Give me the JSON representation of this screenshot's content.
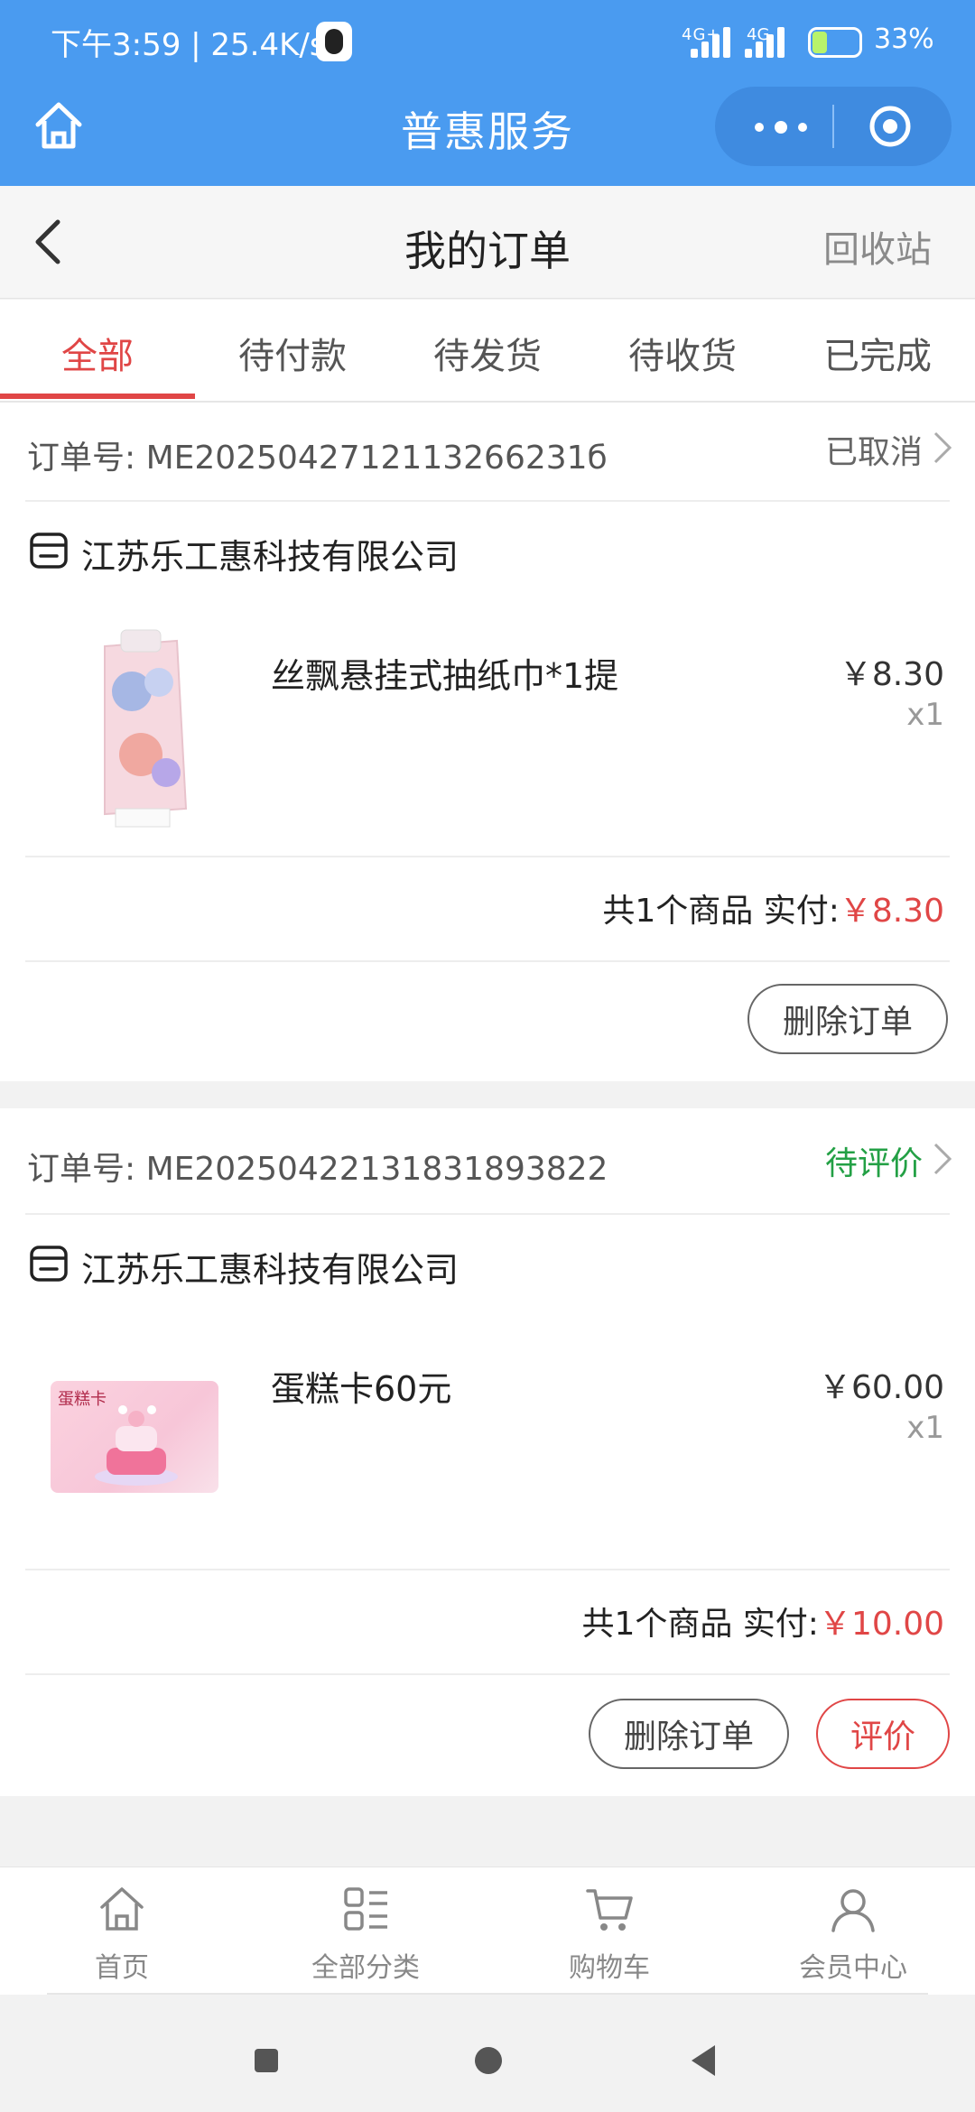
{
  "status_bar": {
    "time_speed": "下午3:59 | 25.4K/s",
    "network_1": "4G+",
    "network_2": "4G",
    "battery_percent": "33%"
  },
  "mini_program": {
    "title": "普惠服务"
  },
  "page": {
    "title": "我的订单",
    "recycle_bin": "回收站"
  },
  "tabs": [
    {
      "label": "全部",
      "active": true
    },
    {
      "label": "待付款"
    },
    {
      "label": "待发货"
    },
    {
      "label": "待收货"
    },
    {
      "label": "已完成"
    }
  ],
  "orders": [
    {
      "order_no": "订单号: ME2025042712113266231б",
      "status": "已取消",
      "shop": "江苏乐工惠科技有限公司",
      "product_name": "丝飘悬挂式抽纸巾*1提",
      "price": "￥8.30",
      "qty": "x1",
      "summary_prefix": "共1个商品 实付:",
      "paid": "￥8.30",
      "buttons": [
        "删除订单"
      ]
    },
    {
      "order_no": "订单号: ME20250422131831893822",
      "status": "待评价",
      "shop": "江苏乐工惠科技有限公司",
      "product_name": "蛋糕卡60元",
      "price": "￥60.00",
      "qty": "x1",
      "summary_prefix": "共1个商品 实付:",
      "paid": "￥10.00",
      "buttons": [
        "删除订单",
        "评价"
      ],
      "card_image_text": "蛋糕卡"
    }
  ],
  "tabbar": [
    {
      "label": "首页",
      "icon": "home-icon"
    },
    {
      "label": "全部分类",
      "icon": "category-icon"
    },
    {
      "label": "购物车",
      "icon": "cart-icon"
    },
    {
      "label": "会员中心",
      "icon": "user-icon"
    }
  ],
  "colors": {
    "header_blue": "#4a9bf0",
    "accent_red": "#e04646",
    "review_green": "#23a045"
  }
}
